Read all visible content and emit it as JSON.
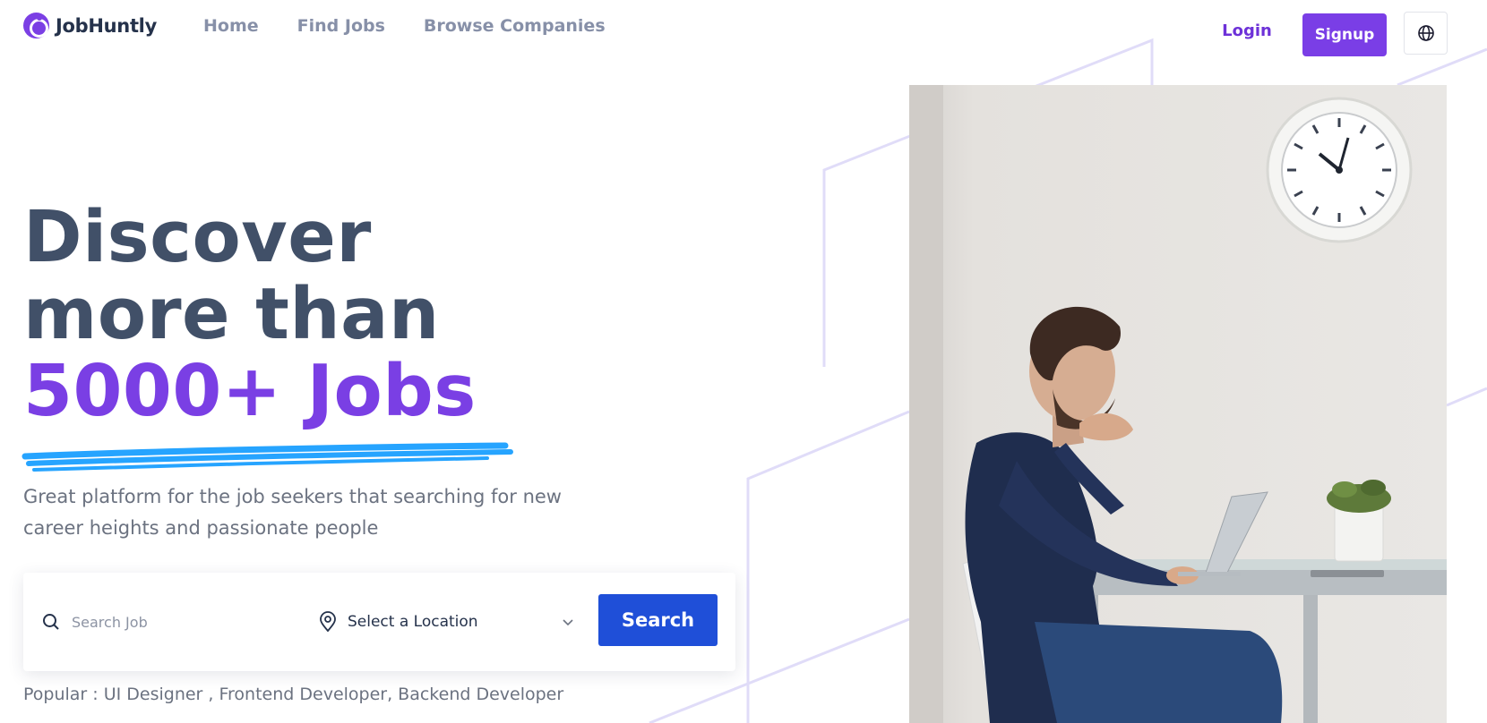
{
  "brand": {
    "name": "JobHuntly"
  },
  "nav": {
    "items": [
      {
        "label": "Home"
      },
      {
        "label": "Find Jobs"
      },
      {
        "label": "Browse Companies"
      }
    ]
  },
  "auth": {
    "login_label": "Login",
    "signup_label": "Signup"
  },
  "hero": {
    "title_line1": "Discover",
    "title_line2": "more than",
    "title_line3": "5000+ Jobs",
    "subtitle": "Great platform for the job seekers that searching for new career heights and passionate people"
  },
  "search": {
    "job_placeholder": "Search Job",
    "location_value": "Select a Location",
    "button_label": "Search"
  },
  "popular": {
    "text": "Popular : UI Designer , Frontend Developer, Backend Developer"
  },
  "colors": {
    "accent": "#7a3ee6",
    "search_button": "#1f4fd8",
    "underline": "#26a4ff",
    "deco_lines": "#e0dcf8"
  },
  "icons": {
    "language": "globe-icon",
    "search": "search-icon",
    "location": "map-pin-icon",
    "dropdown": "chevron-down-icon"
  }
}
